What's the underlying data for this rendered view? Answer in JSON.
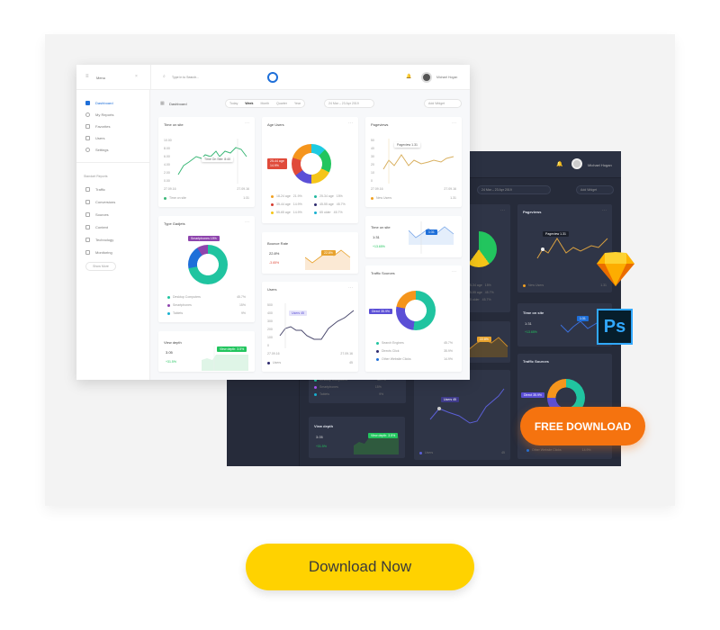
{
  "brand_colors": {
    "orange": "#f5730f",
    "yellow": "#ffd200",
    "dark_bg": "#262b3a",
    "accent_blue": "#1e6fd9"
  },
  "light": {
    "menu_label": "Menu",
    "search_placeholder": "Type in to Search...",
    "user_name": "Michael Hogan",
    "sidebar": {
      "items": [
        {
          "label": "Dashboard",
          "icon": "grid-icon"
        },
        {
          "label": "My Reports",
          "icon": "reports-icon"
        },
        {
          "label": "Favorites",
          "icon": "star-icon"
        },
        {
          "label": "Users",
          "icon": "users-icon"
        },
        {
          "label": "Settings",
          "icon": "gear-icon"
        }
      ],
      "section": "Standart Reports",
      "reports": [
        {
          "label": "Traffic"
        },
        {
          "label": "Conversions"
        },
        {
          "label": "Sources"
        },
        {
          "label": "Content"
        },
        {
          "label": "Technology"
        },
        {
          "label": "Monitoring"
        }
      ],
      "show_more": "Show More"
    },
    "page_title": "Dashboard",
    "periods": [
      "Today",
      "Week",
      "Month",
      "Quarter",
      "Year"
    ],
    "selected_period": "Week",
    "date_range": "24 Mar – 23 Apr 2019",
    "add_widget": "Add Widget",
    "time_on_site": {
      "title": "Time on site",
      "yticks": [
        "10.00",
        "8.00",
        "6.00",
        "4.00",
        "2.00",
        "0.00"
      ],
      "x_start": "27.09.16",
      "x_end": "27.09.16",
      "tooltip": "Time On Site: 8:40",
      "legend": "Time on site",
      "legend_value": "1:31"
    },
    "age_users": {
      "title": "Age Users",
      "tooltip_line1": "25-44 age",
      "tooltip_line2": "14.9%",
      "legend": [
        {
          "label": "18-24 age",
          "value": "21.9%",
          "color": "#f0a020"
        },
        {
          "label": "25-34 age",
          "value": "15%",
          "color": "#20b8a0"
        },
        {
          "label": "35-44 age",
          "value": "14.9%",
          "color": "#d63c2f"
        },
        {
          "label": "45-55 age",
          "value": "45.7%",
          "color": "#2d2a6e"
        },
        {
          "label": "55-65 age",
          "value": "14.9%",
          "color": "#f5c518"
        },
        {
          "label": "65 older",
          "value": "45.7%",
          "color": "#18b0d0"
        }
      ]
    },
    "pageviews": {
      "title": "Pageviews",
      "yticks": [
        "50",
        "40",
        "30",
        "20",
        "10",
        "0"
      ],
      "x_start": "27.09.16",
      "x_end": "27.09.16",
      "tooltip": "Pageview 1.31",
      "legend": "New Users",
      "legend_value": "1.31"
    },
    "type_gadgets": {
      "title": "Type Gadjets",
      "tooltip": "Smartphones 15%",
      "legend": [
        {
          "label": "Desktop Computers",
          "value": "45.7%",
          "color": "#20c4a0"
        },
        {
          "label": "Smartphones",
          "value": "15%",
          "color": "#8e44ad"
        },
        {
          "label": "Tablets",
          "value": "9%",
          "color": "#18b0d0"
        }
      ]
    },
    "bounce_rate": {
      "title": "Bounce Rate",
      "value": "22.8%",
      "change": "-3.65%",
      "tooltip": "22.8%"
    },
    "time_on_site_small": {
      "title": "Time on site",
      "value": "1:31",
      "change": "+13.65%",
      "tooltip": "1:31"
    },
    "users": {
      "title": "Users",
      "yticks": [
        "500",
        "400",
        "300",
        "200",
        "100",
        "0"
      ],
      "x_start": "27.09.16",
      "x_end": "27.09.16",
      "tooltip": "Users 45",
      "legend": "Users",
      "legend_value": "45"
    },
    "traffic_sources": {
      "title": "Traffic Sources",
      "tooltip": "Direct 35.9%",
      "legend": [
        {
          "label": "Search Engines",
          "value": "45.7%",
          "color": "#20c4a0"
        },
        {
          "label": "Directs Click",
          "value": "35.9%",
          "color": "#2d2a6e"
        },
        {
          "label": "Other Website Clicks",
          "value": "14.9%",
          "color": "#1e6fd9"
        }
      ]
    },
    "view_depth": {
      "title": "View depth",
      "value": "3.05",
      "change": "+31.5%",
      "tooltip": "View depth: 3.5%"
    }
  },
  "dark": {
    "user_name": "Michael Hogan",
    "date_range": "24 Mar – 23 Apr 2019",
    "add_widget": "Add Widget",
    "pageviews": {
      "title": "Pageviews",
      "tooltip": "Pageview 1.31",
      "legend": "New Users",
      "legend_value": "1.31"
    },
    "time_on_site": {
      "title": "Time on site",
      "value": "1:31",
      "change": "+13.65%",
      "tooltip": "1:31"
    },
    "traffic_sources": {
      "title": "Traffic Sources",
      "tooltip": "Direct 35.9%",
      "legend_last": "Other Website Clicks",
      "legend_last_value": "14.9%"
    },
    "users": {
      "tooltip": "Users 45",
      "legend": "Users",
      "legend_value": "45"
    },
    "view_depth": {
      "title": "View depth",
      "value": "3.05",
      "change": "+31.5%",
      "tooltip": "View depth: 3.5%"
    },
    "age_legend": [
      {
        "label": "25-34 age",
        "value": "15%"
      },
      {
        "label": "45-55 age",
        "value": "45.7%"
      },
      {
        "label": "65 older",
        "value": "45.7%"
      }
    ],
    "gadget_legend": [
      {
        "label": "Desktop Computers",
        "value": "45.7%"
      },
      {
        "label": "Smartphones",
        "value": "15%"
      },
      {
        "label": "Tablets",
        "value": "9%"
      }
    ],
    "bounce_tooltip": "22.8%"
  },
  "badges": {
    "sketch": "sketch-logo",
    "photoshop": "Ps"
  },
  "free_download": "FREE DOWNLOAD",
  "download_now": "Download Now"
}
